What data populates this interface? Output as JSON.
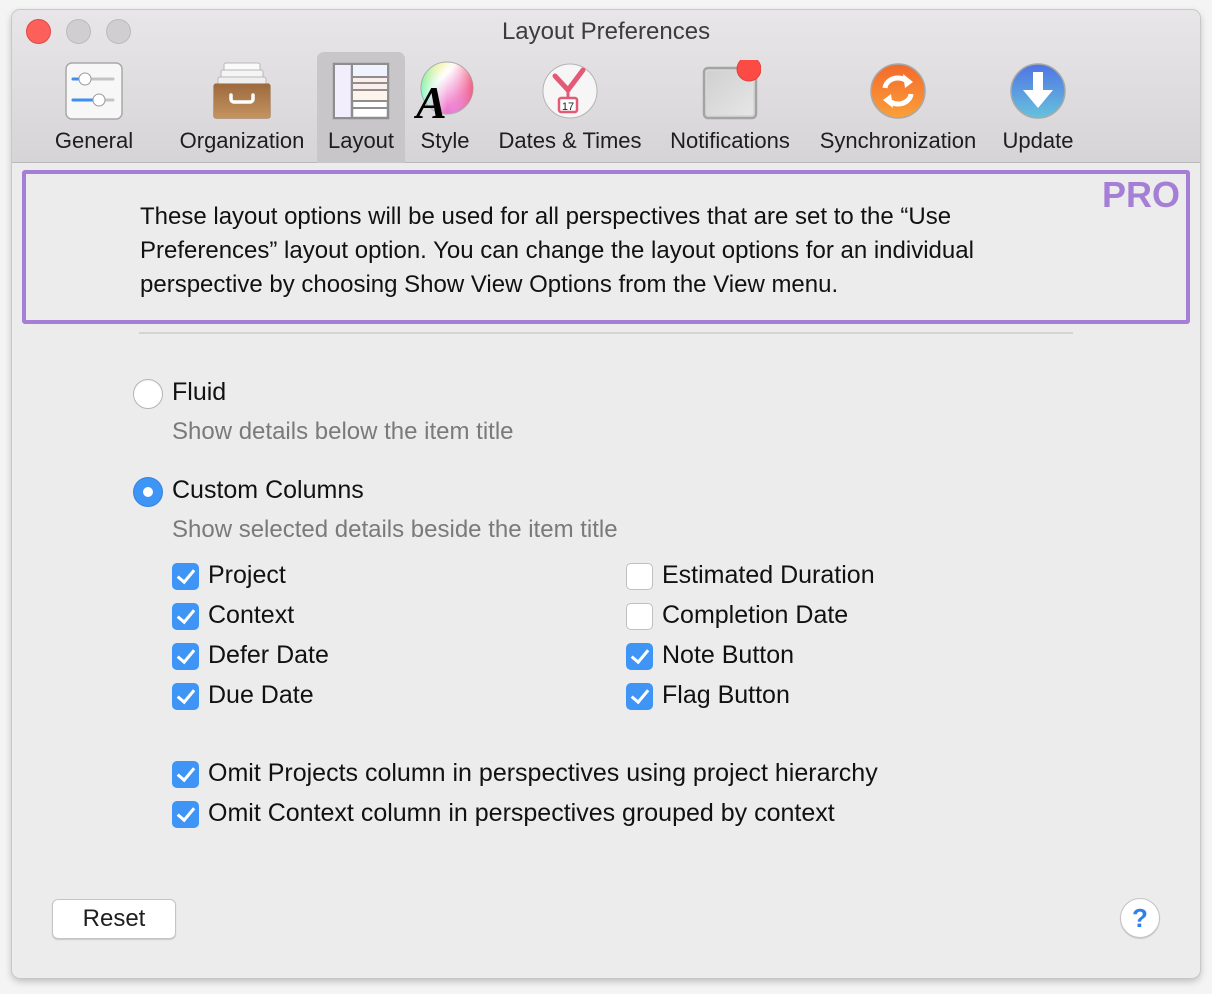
{
  "window": {
    "title": "Layout Preferences",
    "controls": [
      "close",
      "minimize",
      "zoom"
    ]
  },
  "toolbar": {
    "tabs": [
      {
        "label": "General",
        "icon": "sliders-icon",
        "selected": false
      },
      {
        "label": "Organization",
        "icon": "file-drawer-icon",
        "selected": false
      },
      {
        "label": "Layout",
        "icon": "layout-columns-icon",
        "selected": true
      },
      {
        "label": "Style",
        "icon": "color-wheel-font-icon",
        "selected": false
      },
      {
        "label": "Dates & Times",
        "icon": "clock-calendar-icon",
        "selected": false,
        "calendar_day": "17"
      },
      {
        "label": "Notifications",
        "icon": "notification-badge-icon",
        "selected": false
      },
      {
        "label": "Synchronization",
        "icon": "sync-icon",
        "selected": false
      },
      {
        "label": "Update",
        "icon": "download-arrow-icon",
        "selected": false
      }
    ]
  },
  "pro_notice": {
    "text": "These layout options will be used for all perspectives that are set to the “Use Preferences” layout option. You can change the layout options for an individual perspective by choosing Show View Options from the View menu.",
    "badge": "PRO",
    "accent": "#a57fd6"
  },
  "layout_mode": {
    "options": [
      {
        "label": "Fluid",
        "description": "Show details below the item title",
        "selected": false
      },
      {
        "label": "Custom Columns",
        "description": "Show selected details beside the item title",
        "selected": true
      }
    ]
  },
  "columns": {
    "left": [
      {
        "label": "Project",
        "checked": true
      },
      {
        "label": "Context",
        "checked": true
      },
      {
        "label": "Defer Date",
        "checked": true
      },
      {
        "label": "Due Date",
        "checked": true
      }
    ],
    "right": [
      {
        "label": "Estimated Duration",
        "checked": false
      },
      {
        "label": "Completion Date",
        "checked": false
      },
      {
        "label": "Note Button",
        "checked": true
      },
      {
        "label": "Flag Button",
        "checked": true
      }
    ]
  },
  "omit_options": [
    {
      "label": "Omit Projects column in perspectives using project hierarchy",
      "checked": true
    },
    {
      "label": "Omit Context column in perspectives grouped by context",
      "checked": true
    }
  ],
  "footer": {
    "reset_label": "Reset",
    "help_label": "?"
  },
  "colors": {
    "accent_blue": "#3e95f5",
    "pro_purple": "#a57fd6",
    "close_red": "#fc605b"
  }
}
